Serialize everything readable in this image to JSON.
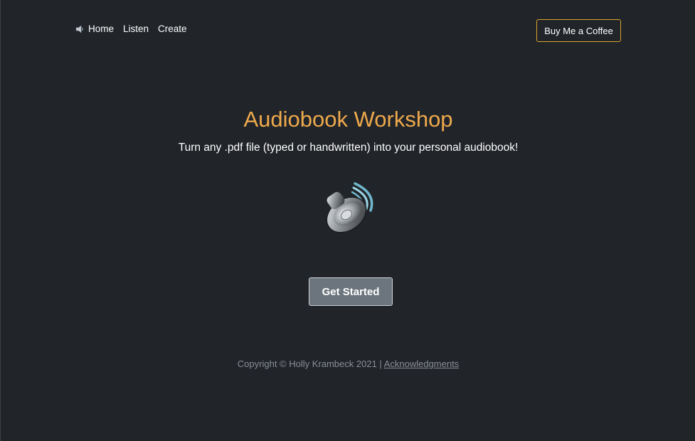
{
  "nav": {
    "items": [
      {
        "label": "Home",
        "icon": "speaker-icon"
      },
      {
        "label": "Listen"
      },
      {
        "label": "Create"
      }
    ],
    "coffee_button": "Buy Me a Coffee"
  },
  "hero": {
    "title": "Audiobook Workshop",
    "subtitle": "Turn any .pdf file (typed or handwritten) into your personal audiobook!",
    "image_icon": "speaker-icon",
    "cta_label": "Get Started"
  },
  "footer": {
    "copyright": "Copyright © Holly Krambeck 2021 | ",
    "acknowledgments": "Acknowledgments"
  },
  "colors": {
    "background": "#212429",
    "title": "#eeaa4c",
    "coffee_border": "#d6a42c",
    "cta_bg": "#6c757d",
    "footer_text": "#8a8f96"
  }
}
